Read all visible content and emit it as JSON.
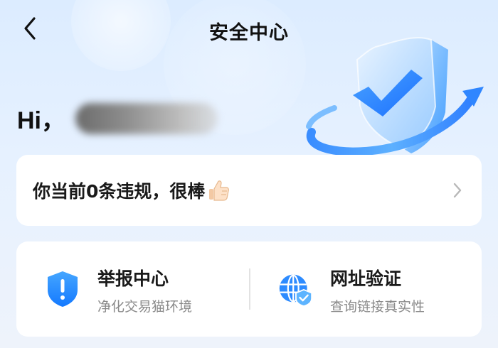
{
  "header": {
    "title": "安全中心"
  },
  "greeting": {
    "text": "Hi，"
  },
  "violation_card": {
    "text": "你当前0条违规，很棒"
  },
  "services": [
    {
      "title": "举报中心",
      "subtitle": "净化交易猫环境",
      "icon": "shield-alert-icon"
    },
    {
      "title": "网址验证",
      "subtitle": "查询链接真实性",
      "icon": "globe-shield-icon"
    }
  ],
  "colors": {
    "accent": "#1f8bff",
    "text_primary": "#1a1a1a",
    "text_secondary": "#8a8a8a",
    "background_top": "#dcecff"
  }
}
